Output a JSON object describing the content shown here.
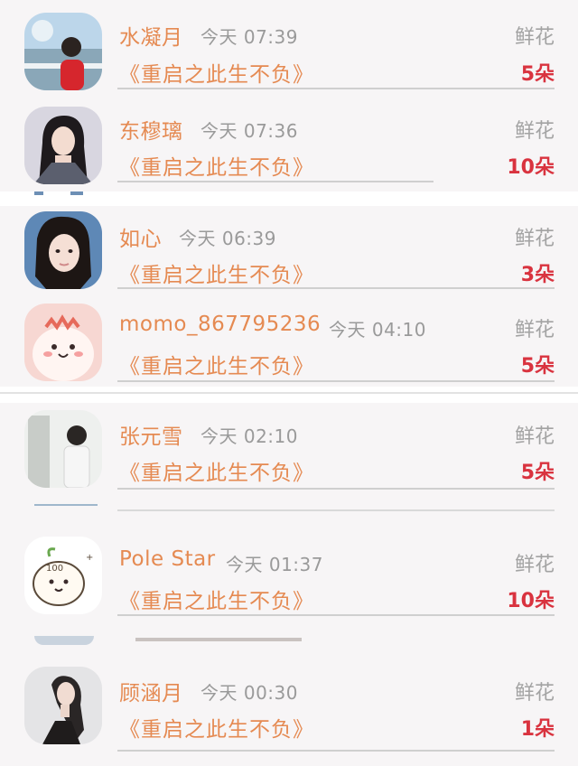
{
  "entries": [
    {
      "name": "水凝月",
      "time": "今天 07:39",
      "gift_type": "鲜花",
      "book": "《重启之此生不负》",
      "count": "5朵"
    },
    {
      "name": "东穆璃",
      "time": "今天 07:36",
      "gift_type": "鲜花",
      "book": "《重启之此生不负》",
      "count": "10朵"
    },
    {
      "name": "如心",
      "time": "今天 06:39",
      "gift_type": "鲜花",
      "book": "《重启之此生不负》",
      "count": "3朵"
    },
    {
      "name": "momo_867795236",
      "time": "今天 04:10",
      "gift_type": "鲜花",
      "book": "《重启之此生不负》",
      "count": "5朵"
    },
    {
      "name": "张元雪",
      "time": "今天 02:10",
      "gift_type": "鲜花",
      "book": "《重启之此生不负》",
      "count": "5朵"
    },
    {
      "name": "Pole Star",
      "time": "今天 01:37",
      "gift_type": "鲜花",
      "book": "《重启之此生不负》",
      "count": "10朵"
    },
    {
      "name": "顾涵月",
      "time": "今天 00:30",
      "gift_type": "鲜花",
      "book": "《重启之此生不负》",
      "count": "1朵"
    }
  ],
  "colors": {
    "name": "#e58a52",
    "time": "#9a9a9a",
    "gift_type": "#a3a3a3",
    "count": "#d9333f",
    "divider": "#cfcfcf",
    "background": "#f7f5f6"
  },
  "avatars": [
    "photo-avatar",
    "photo-avatar",
    "photo-avatar",
    "cartoon-avatar",
    "photo-avatar",
    "cartoon-avatar",
    "photo-avatar"
  ]
}
